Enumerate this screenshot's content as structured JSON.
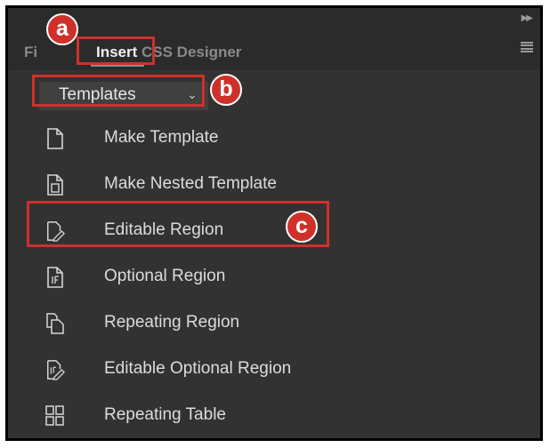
{
  "tabs": {
    "files_label": "Fi",
    "insert_label": "Insert",
    "css_label": "CSS Designer"
  },
  "category_dropdown": {
    "selected": "Templates"
  },
  "items": [
    {
      "label": "Make Template",
      "icon": "document-icon"
    },
    {
      "label": "Make Nested Template",
      "icon": "nested-template-icon"
    },
    {
      "label": "Editable Region",
      "icon": "editable-region-icon"
    },
    {
      "label": "Optional Region",
      "icon": "optional-region-icon"
    },
    {
      "label": "Repeating Region",
      "icon": "repeating-region-icon"
    },
    {
      "label": "Editable Optional Region",
      "icon": "editable-optional-region-icon"
    },
    {
      "label": "Repeating Table",
      "icon": "repeating-table-icon"
    }
  ],
  "callouts": {
    "a": "a",
    "b": "b",
    "c": "c"
  },
  "colors": {
    "panel_bg": "#323232",
    "tab_bar_bg": "#2b2b2b",
    "callout_red": "#d0302a"
  }
}
